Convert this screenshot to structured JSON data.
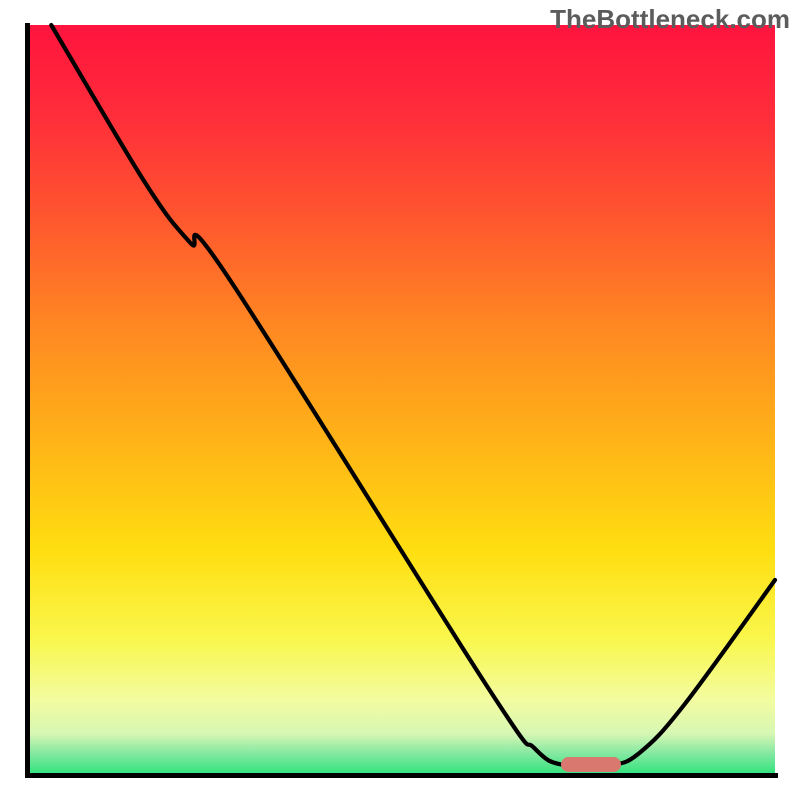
{
  "watermark": "TheBottleneck.com",
  "chart_data": {
    "type": "line",
    "title": "",
    "xlabel": "",
    "ylabel": "",
    "xlim": [
      0,
      100
    ],
    "ylim": [
      0,
      100
    ],
    "gradient_stops": [
      {
        "offset": 0.0,
        "color": "#ff143e"
      },
      {
        "offset": 0.12,
        "color": "#ff2d3a"
      },
      {
        "offset": 0.25,
        "color": "#ff542f"
      },
      {
        "offset": 0.4,
        "color": "#ff8722"
      },
      {
        "offset": 0.55,
        "color": "#ffb218"
      },
      {
        "offset": 0.7,
        "color": "#ffde10"
      },
      {
        "offset": 0.82,
        "color": "#f9f74d"
      },
      {
        "offset": 0.9,
        "color": "#f3fca0"
      },
      {
        "offset": 0.945,
        "color": "#d6f7b3"
      },
      {
        "offset": 0.97,
        "color": "#88e9a2"
      },
      {
        "offset": 1.0,
        "color": "#2ee37b"
      }
    ],
    "curve_points": [
      {
        "x": 3.5,
        "y": 100.0
      },
      {
        "x": 16.0,
        "y": 79.0
      },
      {
        "x": 22.0,
        "y": 71.0
      },
      {
        "x": 27.0,
        "y": 66.5
      },
      {
        "x": 61.5,
        "y": 12.0
      },
      {
        "x": 68.0,
        "y": 3.5
      },
      {
        "x": 72.0,
        "y": 1.3
      },
      {
        "x": 78.0,
        "y": 1.3
      },
      {
        "x": 82.0,
        "y": 3.0
      },
      {
        "x": 88.0,
        "y": 9.5
      },
      {
        "x": 100.0,
        "y": 26.0
      }
    ],
    "marker": {
      "x_center": 75.5,
      "y_center": 1.4,
      "width": 8.0,
      "height": 2.0
    }
  }
}
